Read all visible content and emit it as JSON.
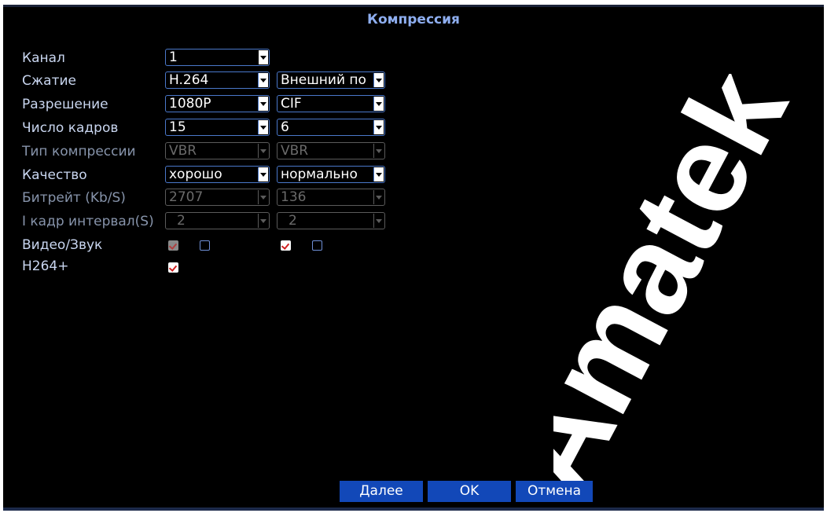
{
  "window": {
    "title": "Компрессия"
  },
  "labels": {
    "channel": "Канал",
    "compression": "Сжатие",
    "resolution": "Разрешение",
    "framerate": "Число кадров",
    "bitrate_type": "Тип компрессии",
    "quality": "Качество",
    "bitrate": "Битрейт (Kb/S)",
    "iframe_interval": "I кадр интервал(S)",
    "video_audio": "Видео/Звук",
    "h264plus": "H264+"
  },
  "main_stream": {
    "channel": "1",
    "compression": "H.264",
    "resolution": "1080P",
    "framerate": "15",
    "bitrate_type": "VBR",
    "quality": "хорошо",
    "bitrate": "2707",
    "iframe_interval": "2",
    "video_enabled": true,
    "audio_enabled": false,
    "h264plus_enabled": true
  },
  "extra_stream": {
    "stream_type": "Внешний по",
    "resolution": "CIF",
    "framerate": "6",
    "bitrate_type": "VBR",
    "quality": "нормально",
    "bitrate": "136",
    "iframe_interval": "2",
    "video_enabled": true,
    "audio_enabled": false
  },
  "buttons": {
    "next": "Далее",
    "ok": "OK",
    "cancel": "Отмена"
  },
  "watermark": {
    "text": "Amatek"
  },
  "colors": {
    "background": "#000000",
    "title": "#8eaef0",
    "label": "#c9d6f0",
    "border": "#4a78ca",
    "button": "#1248b8"
  }
}
